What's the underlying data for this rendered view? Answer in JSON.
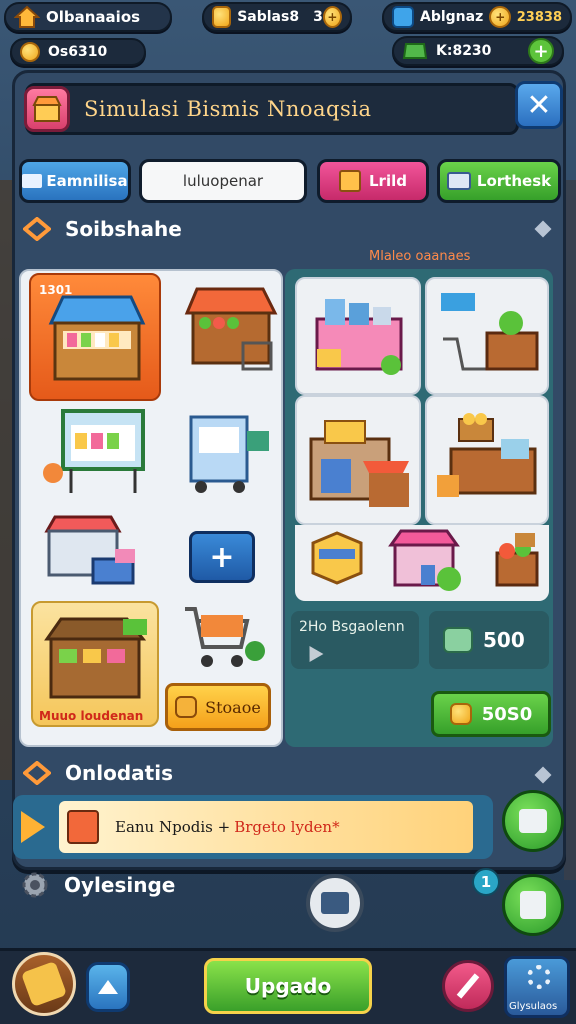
{
  "top_bar": {
    "player_name": "Olbanaaios",
    "currency1_value": "Sablas8",
    "currency1_extra": "3",
    "currency2_label": "Ablgnaz",
    "currency2_value": "23838",
    "sub_value": "Os6310",
    "cash_value": "K:8230"
  },
  "header": {
    "title": "Simulasi Bismis Nnoaqsia"
  },
  "tabs": [
    {
      "label": "Eamnilisa"
    },
    {
      "label": "luluopenar"
    },
    {
      "label": "Lrild"
    },
    {
      "label": "Lorthesk"
    }
  ],
  "section_shop": {
    "title": "Soibshahe",
    "right_caption": "Mlaleo oaanaes"
  },
  "left_items": {
    "stall_badge": "1301",
    "featured_caption": "Muuo loudenan",
    "store_button": "Stoaoe"
  },
  "stats": {
    "stat_label": "2Ho Bsgaolenn",
    "stat_value": "500",
    "buy_price": "50S0"
  },
  "section_orders": {
    "title": "Onlodatis",
    "banner_text_dark": "Eanu Npodis +",
    "banner_text_red": "Brgeto lyden*"
  },
  "section_settings": {
    "title": "Oylesinge",
    "badge": "1"
  },
  "bottom_bar": {
    "upgrade_label": "Upgado",
    "right_label": "Glysulaos"
  },
  "colors": {
    "accent_green": "#5dc43b",
    "accent_orange": "#ffb234",
    "accent_blue": "#3a8ad8",
    "title_gold": "#ffd58a"
  }
}
